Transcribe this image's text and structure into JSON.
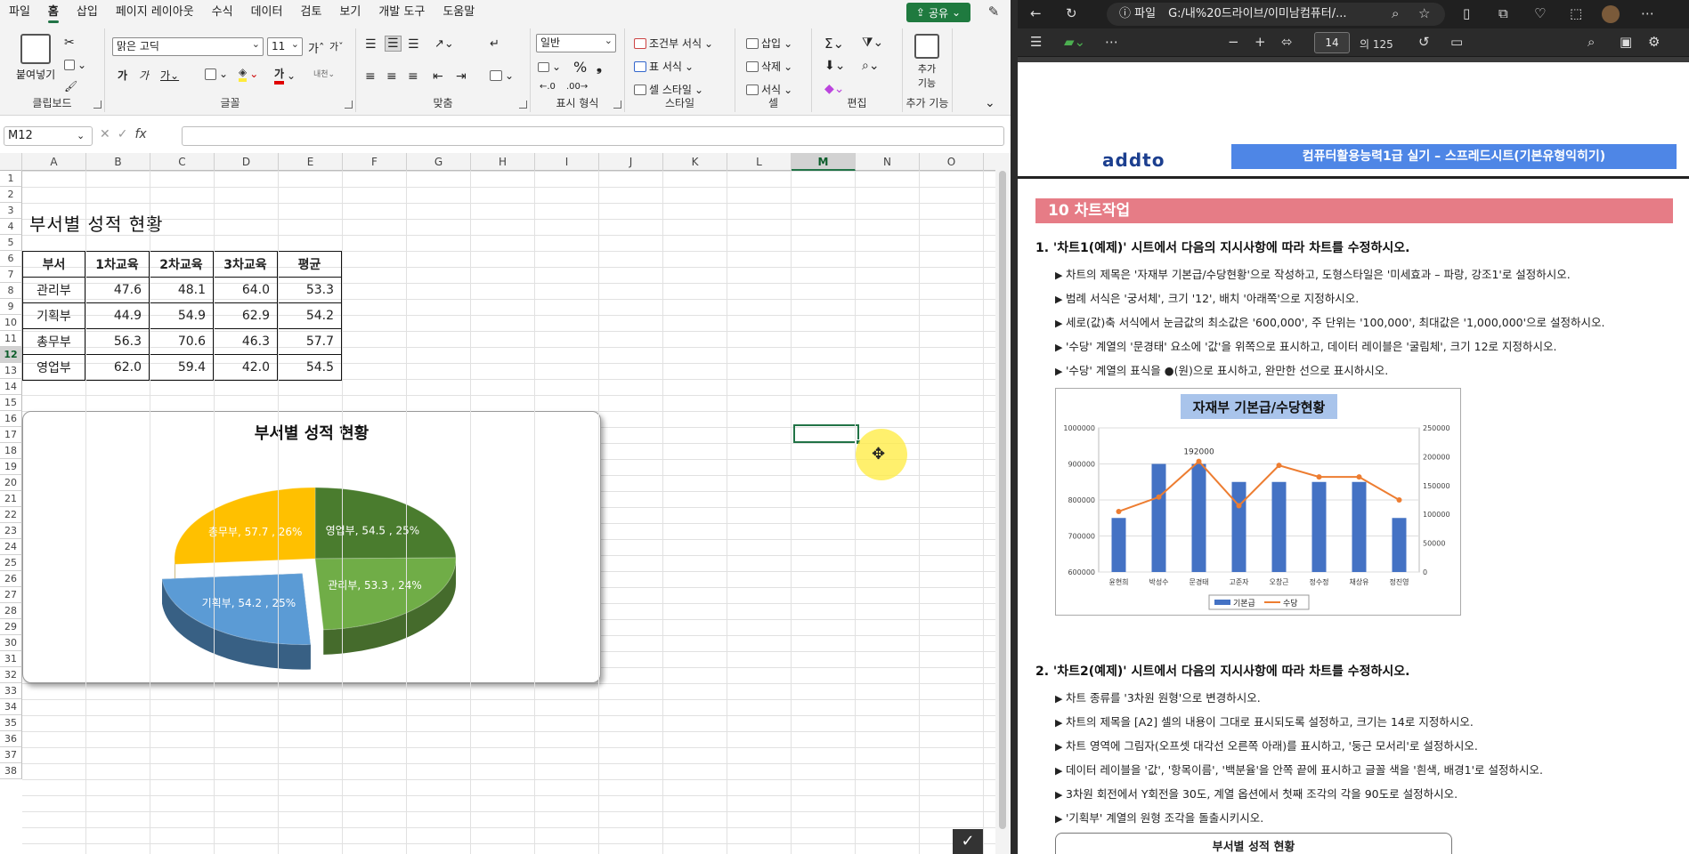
{
  "excel": {
    "menu_tabs": [
      "파일",
      "홈",
      "삽입",
      "페이지 레이아웃",
      "수식",
      "데이터",
      "검토",
      "보기",
      "개발 도구",
      "도움말"
    ],
    "share_label": "공유",
    "ribbon": {
      "paste_label": "붙여넣기",
      "clipboard_label": "클립보드",
      "font_name": "맑은 고딕",
      "font_size": "11",
      "font_label": "글꼴",
      "align_label": "맞춤",
      "number_format": "일반",
      "number_label": "표시 형식",
      "cond_format": "조건부 서식",
      "table_format": "표 서식",
      "cell_style": "셀 스타일",
      "style_label": "스타일",
      "insert": "삽입",
      "delete": "삭제",
      "format": "서식",
      "cells_label": "셀",
      "edit_label": "편집",
      "addin_button": "추가 기능",
      "addin_label": "추가 기능"
    },
    "name_box": "M12",
    "columns": [
      "A",
      "B",
      "C",
      "D",
      "E",
      "F",
      "G",
      "H",
      "I",
      "J",
      "K",
      "L",
      "M",
      "N",
      "O"
    ],
    "selected_column": "M",
    "rows": [
      "1",
      "2",
      "3",
      "4",
      "5",
      "6",
      "7",
      "8",
      "9",
      "10",
      "11",
      "12",
      "13",
      "14",
      "15",
      "16",
      "17",
      "18",
      "19",
      "20",
      "21",
      "22",
      "23",
      "24",
      "25",
      "26",
      "27",
      "28",
      "29",
      "30",
      "31",
      "32",
      "33",
      "34",
      "35",
      "36",
      "37",
      "38"
    ],
    "selected_row": "12",
    "sheet_title": "부서별 성적 현황",
    "table": {
      "headers": [
        "부서",
        "1차교육",
        "2차교육",
        "3차교육",
        "평균"
      ],
      "rows": [
        [
          "관리부",
          "47.6",
          "48.1",
          "64.0",
          "53.3"
        ],
        [
          "기획부",
          "44.9",
          "54.9",
          "62.9",
          "54.2"
        ],
        [
          "총무부",
          "56.3",
          "70.6",
          "46.3",
          "57.7"
        ],
        [
          "영업부",
          "62.0",
          "59.4",
          "42.0",
          "54.5"
        ]
      ]
    }
  },
  "chart_data": [
    {
      "type": "pie",
      "title": "부서별 성적 현황",
      "categories": [
        "관리부",
        "기획부",
        "총무부",
        "영업부"
      ],
      "values": [
        53.3,
        54.2,
        57.7,
        54.5
      ],
      "data_labels": [
        "관리부, 53.3 , 24%",
        "기획부, 54.2 , 25%",
        "총무부, 57.7 , 26%",
        "영업부, 54.5 , 25%"
      ],
      "colors": [
        "#70ad47",
        "#5b9bd5",
        "#ffc000",
        "#4a7c2e"
      ],
      "exploded": "기획부",
      "style": "3D pie"
    },
    {
      "type": "bar",
      "title": "자재부 기본급/수당현황",
      "categories": [
        "윤현희",
        "박성수",
        "문경태",
        "고준자",
        "오창근",
        "정수정",
        "채상유",
        "정진영"
      ],
      "series": [
        {
          "name": "기본급",
          "type": "bar",
          "axis": "left",
          "values": [
            750000,
            900000,
            900000,
            850000,
            850000,
            850000,
            850000,
            750000
          ]
        },
        {
          "name": "수당",
          "type": "line",
          "axis": "right",
          "values": [
            105000,
            130000,
            192000,
            115000,
            185000,
            165000,
            165000,
            125000
          ]
        }
      ],
      "ylim_left": [
        600000,
        1000000
      ],
      "ylim_right": [
        0,
        250000
      ],
      "y_ticks_left": [
        "1000000",
        "900000",
        "800000",
        "700000",
        "600000"
      ],
      "y_ticks_right": [
        "250000",
        "200000",
        "150000",
        "100000",
        "50000",
        "0"
      ],
      "annotation": "192000",
      "legend": "bottom",
      "colors": {
        "bar": "#4472c4",
        "line": "#ed7d31"
      }
    }
  ],
  "pdf": {
    "url": "G:/내%20드라이브/이미남컴퓨터/...",
    "file_label": "파일",
    "page": "14",
    "page_total": "의 125",
    "logo": "addto",
    "banner": "컴퓨터활용능력1급 실기 – 스프레드시트(기본유형익히기)",
    "section": "10  차트작업",
    "q1": "1. '차트1(예제)' 시트에서 다음의 지시사항에 따라 차트를 수정하시오.",
    "q1_items": [
      "차트의 제목은 '자재부 기본급/수당현황'으로 작성하고, 도형스타일은 '미세효과 – 파랑, 강조1'로 설정하시오.",
      "범례 서식은 '궁서체', 크기 '12', 배치 '아래쪽'으로 지정하시오.",
      "세로(값)축 서식에서 눈금값의 최소값은 '600,000', 주 단위는 '100,000', 최대값은 '1,000,000'으로 설정하시오.",
      "'수당' 계열의 '문경태' 요소에 '값'을 위쪽으로 표시하고, 데이터 레이블은 '굴림체', 크기 12로 지정하시오.",
      "'수당' 계열의 표식을 ●(원)으로 표시하고, 완만한 선으로 표시하시오."
    ],
    "q2": "2. '차트2(예제)' 시트에서 다음의 지시사항에 따라 차트를 수정하시오.",
    "q2_items": [
      "차트 종류를 '3차원 원형'으로 변경하시오.",
      "차트의 제목을 [A2] 셀의 내용이 그대로 표시되도록 설정하고, 크기는 14로 지정하시오.",
      "차트 영역에 그림자(오프셋 대각선 오른쪽 아래)를 표시하고, '둥근 모서리'로 설정하시오.",
      "데이터 레이블을 '값', '항목이름', '백분율'을 안쪽 끝에 표시하고 글꼴 색을 '흰색, 배경1'로 설정하시오.",
      "3차원 회전에서 Y회전을 30도, 계열 옵션에서 첫째 조각의 각을 90도로 설정하시오.",
      "'기획부' 계열의 원형 조각을 돌출시키시오."
    ],
    "sample2_title": "부서별 성적 현황"
  }
}
